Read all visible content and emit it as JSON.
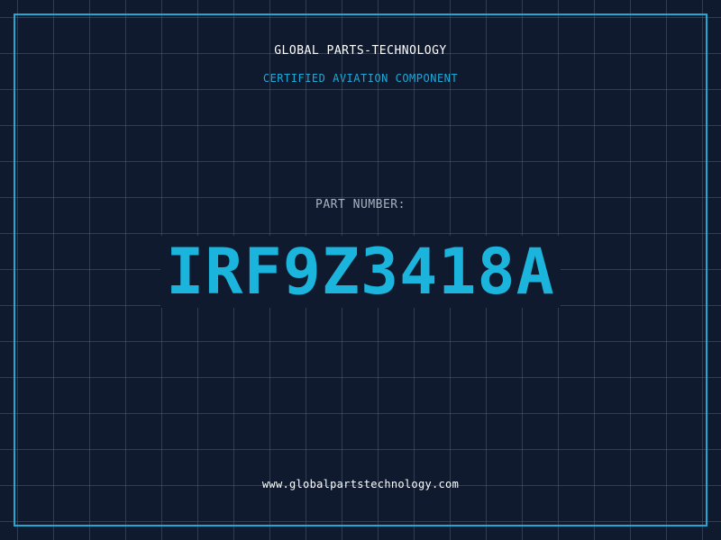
{
  "header": {
    "company": "GLOBAL PARTS-TECHNOLOGY",
    "subtitle": "CERTIFIED AVIATION COMPONENT"
  },
  "part": {
    "label": "PART NUMBER:",
    "number": "IRF9Z3418A"
  },
  "footer": {
    "url": "www.globalpartstechnology.com"
  },
  "colors": {
    "background": "#101a2e",
    "grid": "#266982",
    "accent": "#1fa9d4",
    "part_number": "#1ab4dc",
    "label": "#a7b1c2",
    "text": "#ffffff"
  }
}
